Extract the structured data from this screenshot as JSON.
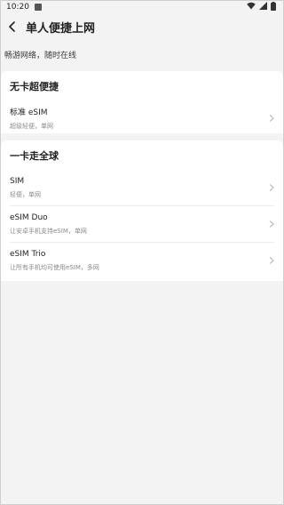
{
  "status_bar": {
    "time": "10:20"
  },
  "header": {
    "title": "单人便捷上网"
  },
  "subtitle": "畅游网络，随时在线",
  "sections": [
    {
      "title": "无卡超便捷",
      "items": [
        {
          "label": "标准 eSIM",
          "desc": "超级轻便，单网"
        }
      ]
    },
    {
      "title": "一卡走全球",
      "items": [
        {
          "label": "SIM",
          "desc": "轻便，单网"
        },
        {
          "label": "eSIM Duo",
          "desc": "让安卓手机支持eSIM，单网"
        },
        {
          "label": "eSIM Trio",
          "desc": "让所有手机均可使用eSIM，多网"
        }
      ]
    }
  ],
  "icons": {
    "back": "chevron-left-icon",
    "chevron": "chevron-right-icon",
    "wifi": "wifi-icon",
    "signal": "signal-icon",
    "battery": "battery-icon",
    "notification": "notification-icon"
  },
  "colors": {
    "background": "#f3f3f3",
    "card": "#ffffff",
    "chevron": "#b5b5b5",
    "secondary_text": "#8a8a8a"
  }
}
